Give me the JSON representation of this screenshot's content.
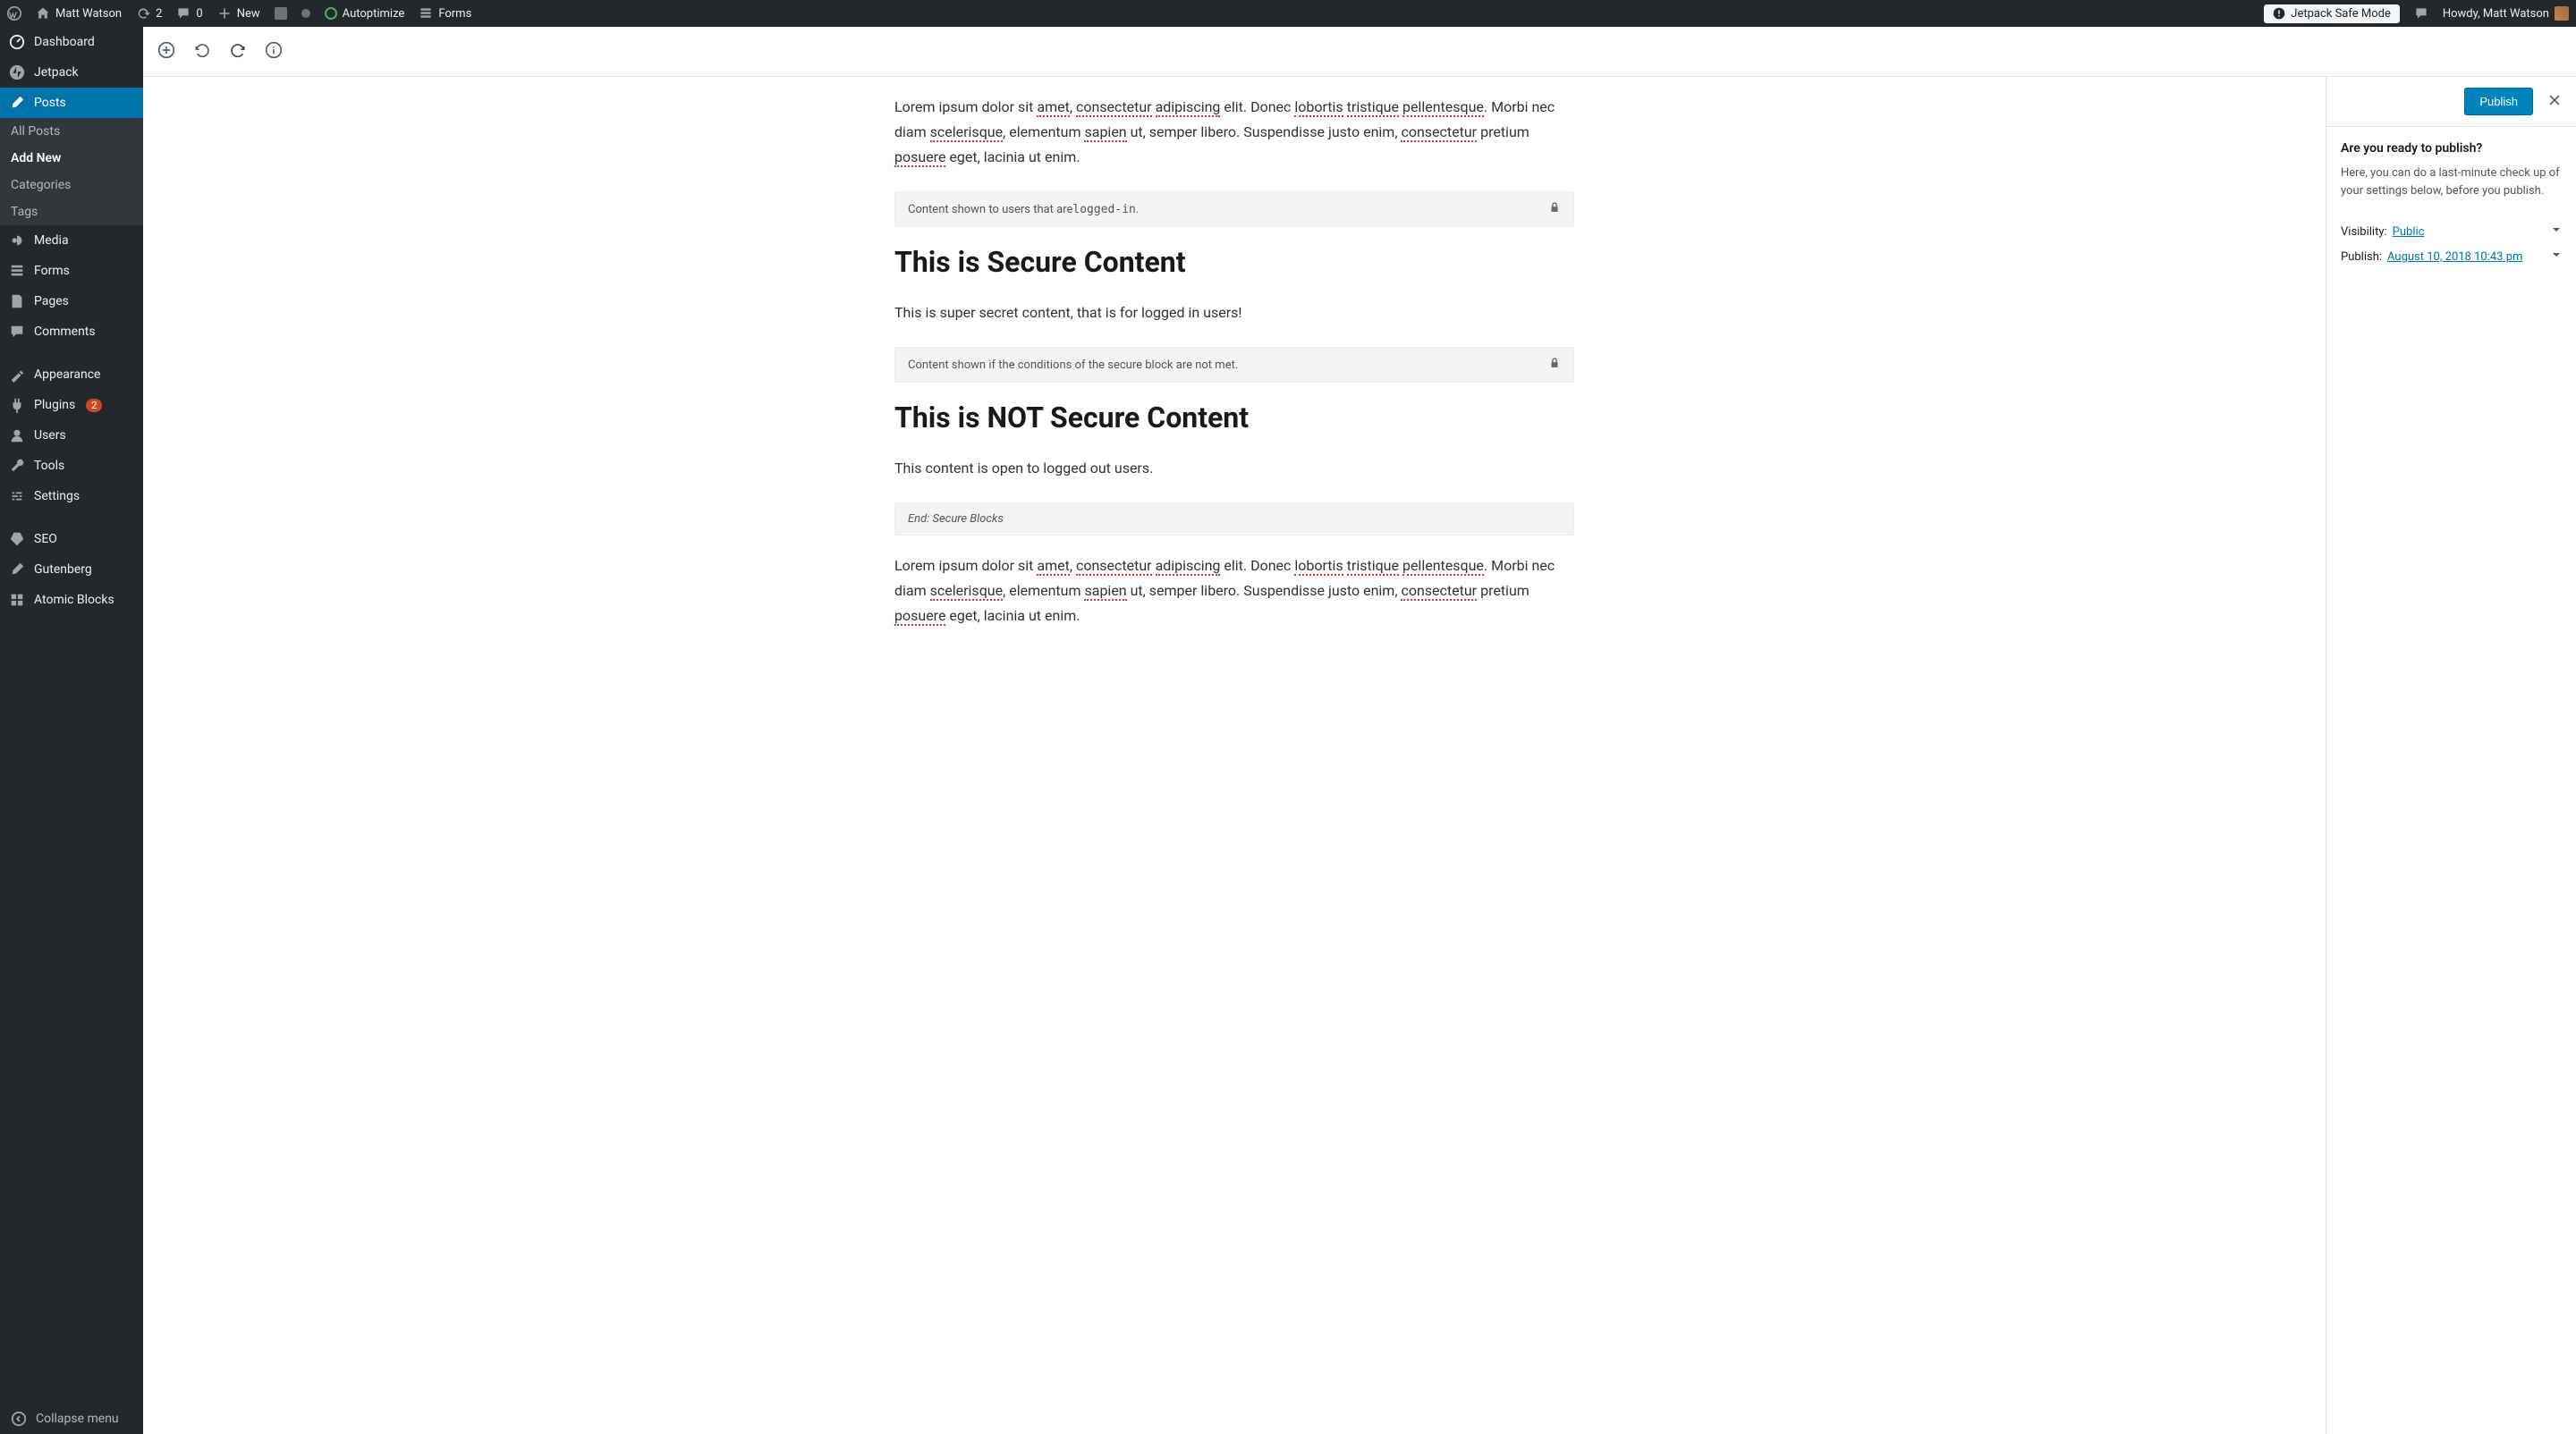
{
  "adminBar": {
    "siteName": "Matt Watson",
    "stats": {
      "refresh": "2",
      "comments": "0"
    },
    "newLabel": "New",
    "autoptimize": "Autoptimize",
    "forms": "Forms",
    "safeMode": "Jetpack Safe Mode",
    "howdy": "Howdy, Matt Watson"
  },
  "sidebar": {
    "dashboard": "Dashboard",
    "jetpack": "Jetpack",
    "posts": "Posts",
    "postsSub": {
      "all": "All Posts",
      "add": "Add New",
      "cats": "Categories",
      "tags": "Tags"
    },
    "media": "Media",
    "forms": "Forms",
    "pages": "Pages",
    "comments": "Comments",
    "appearance": "Appearance",
    "plugins": "Plugins",
    "pluginsBadge": "2",
    "users": "Users",
    "tools": "Tools",
    "settings": "Settings",
    "seo": "SEO",
    "gutenberg": "Gutenberg",
    "atomic": "Atomic Blocks",
    "collapse": "Collapse menu"
  },
  "content": {
    "para1a": "Lorem ipsum dolor sit ",
    "w_amet": "amet",
    "sep1": ", ",
    "w_cons": "consectetur",
    "sp": " ",
    "w_adip": "adipiscing",
    "para1b": " elit. Donec ",
    "w_lob": "lobortis",
    "w_trist": "tristique",
    "w_pell": "pellentesque",
    "para1c": ". Morbi nec diam ",
    "w_scel": "scelerisque",
    "para1d": ", elementum ",
    "w_sap": "sapien",
    "para1e": " ut, semper libero. Suspendisse justo enim, ",
    "w_cons2": "consectetur",
    "para1f": " pretium ",
    "w_pos": "posuere",
    "para1g": " eget, lacinia ut enim.",
    "block1a": "Content shown to users that are ",
    "block1code": "logged-in",
    "block1b": ".",
    "h1": "This is Secure Content",
    "para2": "This is super secret content, that is for logged in users!",
    "block2": "Content shown if the conditions of the secure block are not met.",
    "h2": "This is NOT Secure Content",
    "para3": "This content is open to logged out users.",
    "blockEnd": "End: Secure Blocks"
  },
  "panel": {
    "publish": "Publish",
    "ready": "Are you ready to publish?",
    "desc": "Here, you can do a last-minute check up of your settings below, before you publish.",
    "visLabel": "Visibility:",
    "visValue": "Public",
    "pubLabel": "Publish:",
    "pubValue": "August 10, 2018 10:43 pm"
  }
}
